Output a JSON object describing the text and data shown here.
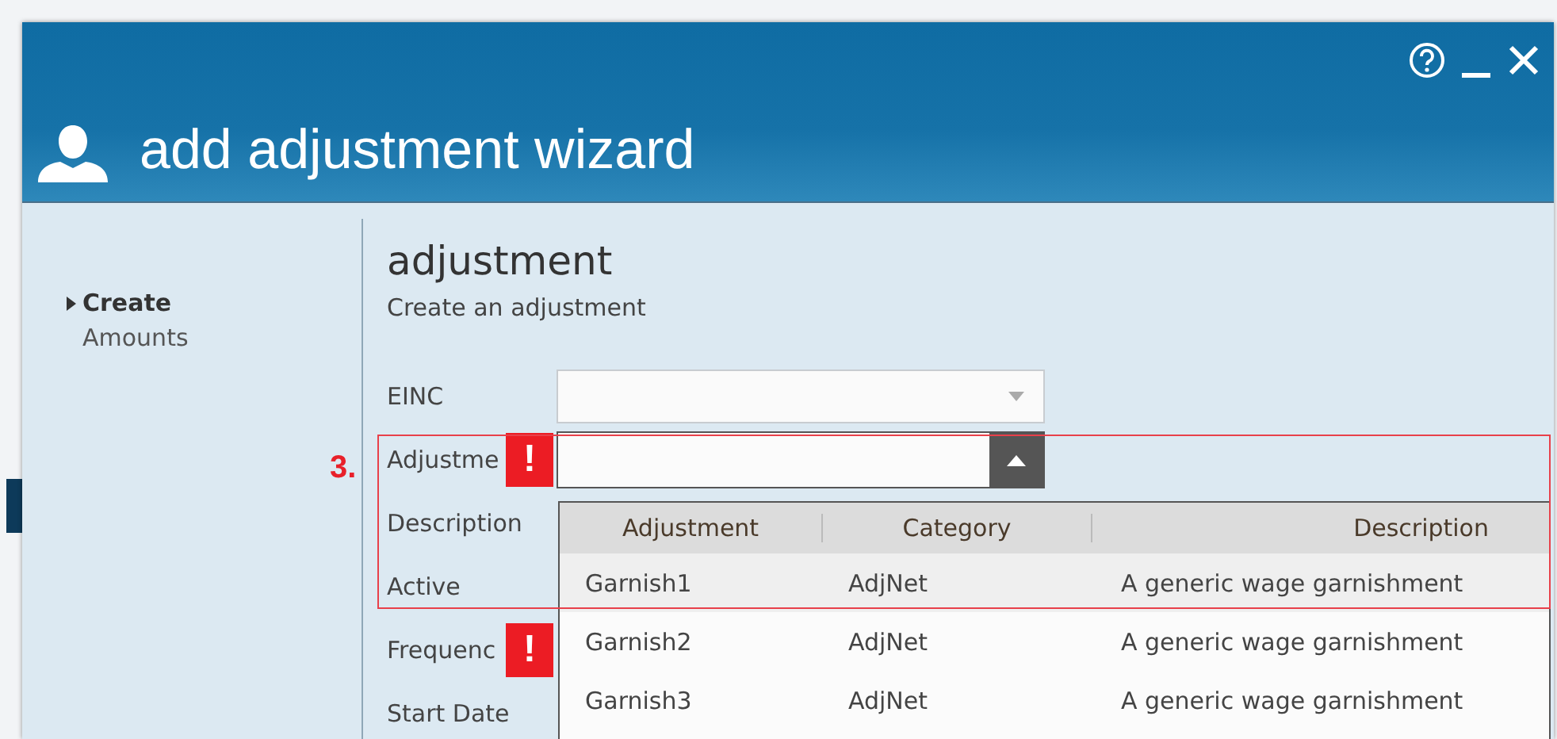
{
  "window": {
    "title": "add adjustment wizard",
    "controls": [
      {
        "kind": "help"
      },
      {
        "kind": "minimize"
      },
      {
        "kind": "close"
      }
    ]
  },
  "nav": [
    {
      "label": "Create",
      "selected": true
    },
    {
      "label": "Amounts",
      "selected": false
    }
  ],
  "page": {
    "title": "adjustment",
    "subtitle": "Create an adjustment"
  },
  "annotation": {
    "number": "3."
  },
  "form": [
    {
      "label": "EINC",
      "kind": "select",
      "error": false
    },
    {
      "label": "Adjustme",
      "kind": "combo",
      "error": true,
      "badge": "!",
      "expanded": true
    },
    {
      "label": "Description",
      "kind": "covered",
      "error": false
    },
    {
      "label": "Active",
      "kind": "covered",
      "error": false
    },
    {
      "label": "Frequenc",
      "kind": "covered",
      "error": true,
      "badge": "!"
    },
    {
      "label": "Start Date",
      "kind": "covered",
      "error": false
    }
  ],
  "dropdown": {
    "columns": [
      "Adjustment",
      "Category",
      "Description"
    ],
    "rows": [
      {
        "cells": [
          "Garnish1",
          "AdjNet",
          "A generic wage garnishment"
        ],
        "selected": true
      },
      {
        "cells": [
          "Garnish2",
          "AdjNet",
          "A generic wage garnishment"
        ],
        "selected": false
      },
      {
        "cells": [
          "Garnish3",
          "AdjNet",
          "A generic wage garnishment"
        ],
        "selected": false
      }
    ]
  }
}
